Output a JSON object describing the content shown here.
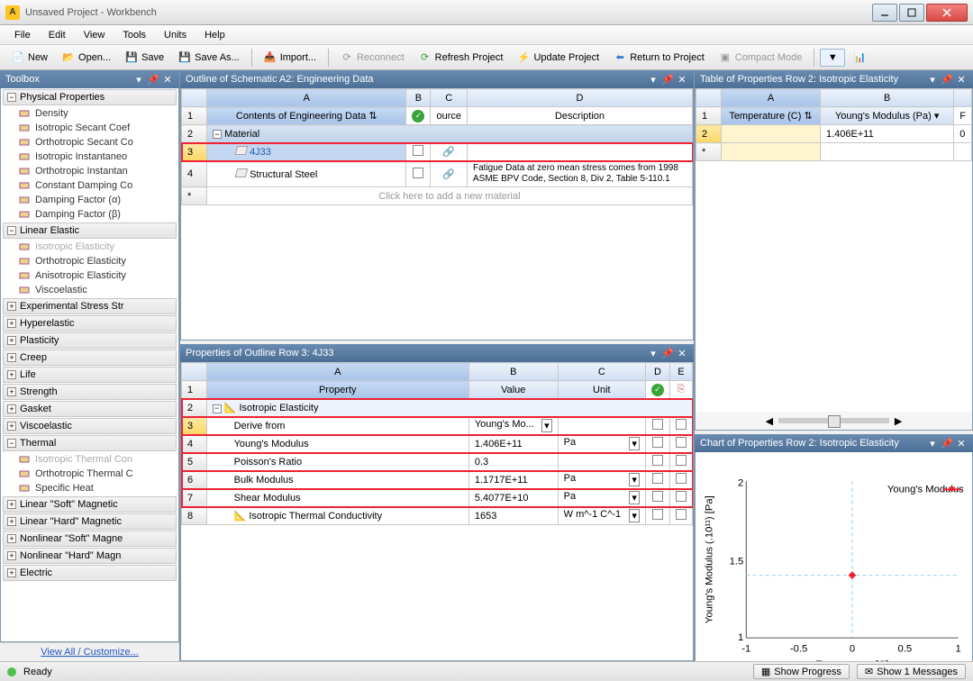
{
  "window": {
    "title": "Unsaved Project - Workbench"
  },
  "menu": {
    "file": "File",
    "edit": "Edit",
    "view": "View",
    "tools": "Tools",
    "units": "Units",
    "help": "Help"
  },
  "toolbar": {
    "new": "New",
    "open": "Open...",
    "save": "Save",
    "save_as": "Save As...",
    "import": "Import...",
    "reconnect": "Reconnect",
    "refresh": "Refresh Project",
    "update": "Update Project",
    "return": "Return to Project",
    "compact": "Compact Mode"
  },
  "toolbox": {
    "title": "Toolbox",
    "groups": {
      "physical": {
        "label": "Physical Properties",
        "items": [
          "Density",
          "Isotropic Secant Coef",
          "Orthotropic Secant Co",
          "Isotropic Instantaneo",
          "Orthotropic Instantan",
          "Constant Damping Co",
          "Damping Factor (α)",
          "Damping Factor (β)"
        ]
      },
      "linear": {
        "label": "Linear Elastic",
        "items": [
          "Isotropic Elasticity",
          "Orthotropic Elasticity",
          "Anisotropic Elasticity",
          "Viscoelastic"
        ],
        "disabled": [
          0
        ]
      },
      "others": [
        "Experimental Stress Str",
        "Hyperelastic",
        "Plasticity",
        "Creep",
        "Life",
        "Strength",
        "Gasket",
        "Viscoelastic"
      ],
      "thermal": {
        "label": "Thermal",
        "items": [
          "Isotropic Thermal Con",
          "Orthotropic Thermal C",
          "Specific Heat"
        ],
        "disabled": [
          0
        ]
      },
      "others2": [
        "Linear \"Soft\" Magnetic",
        "Linear \"Hard\" Magnetic",
        "Nonlinear \"Soft\" Magne",
        "Nonlinear \"Hard\" Magn",
        "Electric"
      ]
    },
    "view_all": "View All / Customize..."
  },
  "outline": {
    "title": "Outline of Schematic A2: Engineering Data",
    "colA": "A",
    "colB": "B",
    "colC": "C",
    "colD": "D",
    "header_contents": "Contents of Engineering Data",
    "header_source": "ource",
    "header_desc": "Description",
    "material_header": "Material",
    "rows": [
      {
        "n": 3,
        "name": "4J33",
        "desc": "",
        "sel": true
      },
      {
        "n": 4,
        "name": "Structural Steel",
        "desc": "Fatigue Data at zero mean stress comes from 1998 ASME BPV Code, Section 8, Div 2, Table 5-110.1"
      }
    ],
    "add_hint": "Click here to add a new material"
  },
  "props": {
    "title": "Properties of Outline Row 3: 4J33",
    "colA": "A",
    "colB": "B",
    "colC": "C",
    "colD": "D",
    "colE": "E",
    "hdr_prop": "Property",
    "hdr_val": "Value",
    "hdr_unit": "Unit",
    "rows": [
      {
        "n": 2,
        "label": "Isotropic Elasticity",
        "kind": "hdr"
      },
      {
        "n": 3,
        "label": "Derive from",
        "value": "Young's Mo...",
        "unit": "",
        "sel": true
      },
      {
        "n": 4,
        "label": "Young's Modulus",
        "value": "1.406E+11",
        "unit": "Pa"
      },
      {
        "n": 5,
        "label": "Poisson's Ratio",
        "value": "0.3",
        "unit": ""
      },
      {
        "n": 6,
        "label": "Bulk Modulus",
        "value": "1.1717E+11",
        "unit": "Pa"
      },
      {
        "n": 7,
        "label": "Shear Modulus",
        "value": "5.4077E+10",
        "unit": "Pa"
      },
      {
        "n": 8,
        "label": "Isotropic Thermal Conductivity",
        "value": "1653",
        "unit": "W m^-1 C^-1",
        "icon": true
      }
    ]
  },
  "table_props": {
    "title": "Table of Properties Row 2: Isotropic Elasticity",
    "colA": "A",
    "colB": "B",
    "hdr_temp": "Temperature (C)",
    "hdr_ym": "Young's Modulus (Pa)",
    "rows": [
      {
        "n": 2,
        "t": "",
        "y": "1.406E+11"
      }
    ]
  },
  "chart": {
    "title": "Chart of Properties Row 2: Isotropic Elasticity",
    "legend": "Young's Modulus",
    "ylabel": "Young's Modulus  (.10¹¹) [Pa]",
    "xlabel": "Temperature  [C]"
  },
  "chart_data": {
    "type": "scatter",
    "x": [
      0
    ],
    "y": [
      1.406
    ],
    "title": "Chart of Properties Row 2: Isotropic Elasticity",
    "xlabel": "Temperature  [C]",
    "ylabel": "Young's Modulus (.10^11) [Pa]",
    "xlim": [
      -1,
      1
    ],
    "ylim": [
      1,
      2
    ],
    "legend": [
      "Young's Modulus"
    ]
  },
  "status": {
    "ready": "Ready",
    "show_progress": "Show Progress",
    "show_messages": "Show 1 Messages"
  }
}
